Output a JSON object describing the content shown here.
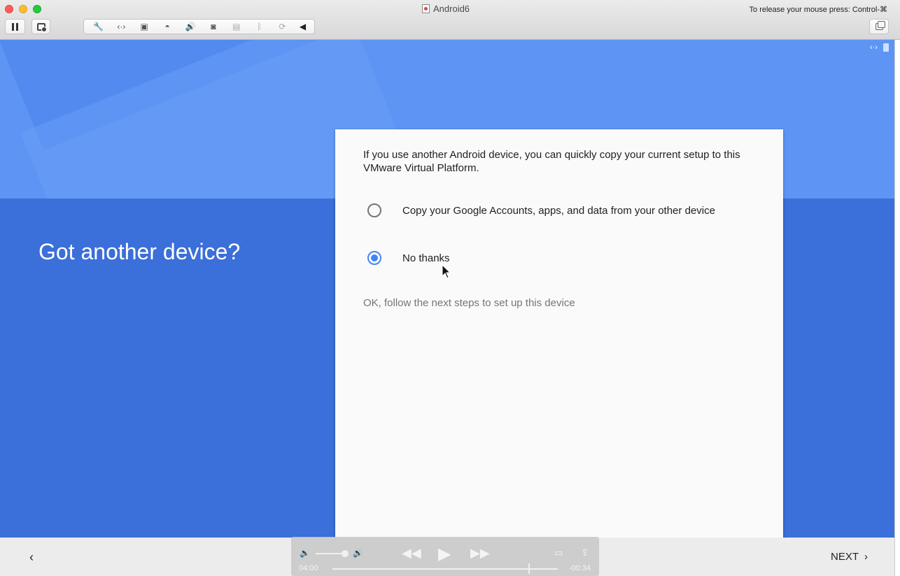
{
  "window": {
    "title": "Android6",
    "release_hint": "To release your mouse press: Control-⌘"
  },
  "toolbar": {
    "icons": [
      "pause-icon",
      "snapshot-icon",
      "wrench-icon",
      "network-icon",
      "disk-icon",
      "hard-drive-icon",
      "sound-icon",
      "camera-icon",
      "usb-icon",
      "bluetooth-icon",
      "sharing-icon",
      "collapse-icon",
      "restore-window-icon"
    ]
  },
  "setup": {
    "heading": "Got another device?",
    "intro": "If you use another Android device, you can quickly copy your current setup to this VMware Virtual Platform.",
    "options": [
      {
        "label": "Copy your Google Accounts, apps, and data from your other device",
        "selected": false
      },
      {
        "label": "No thanks",
        "selected": true
      }
    ],
    "hint": "OK, follow the next steps to set up this device"
  },
  "navigation": {
    "back_glyph": "‹",
    "next_label": "NEXT"
  },
  "media": {
    "time_elapsed": "04:00",
    "time_remaining": "-00:34",
    "progress": 0.88
  },
  "colors": {
    "hero": "#5e95f5",
    "background": "#3b6fd9",
    "accent": "#4285f4"
  }
}
